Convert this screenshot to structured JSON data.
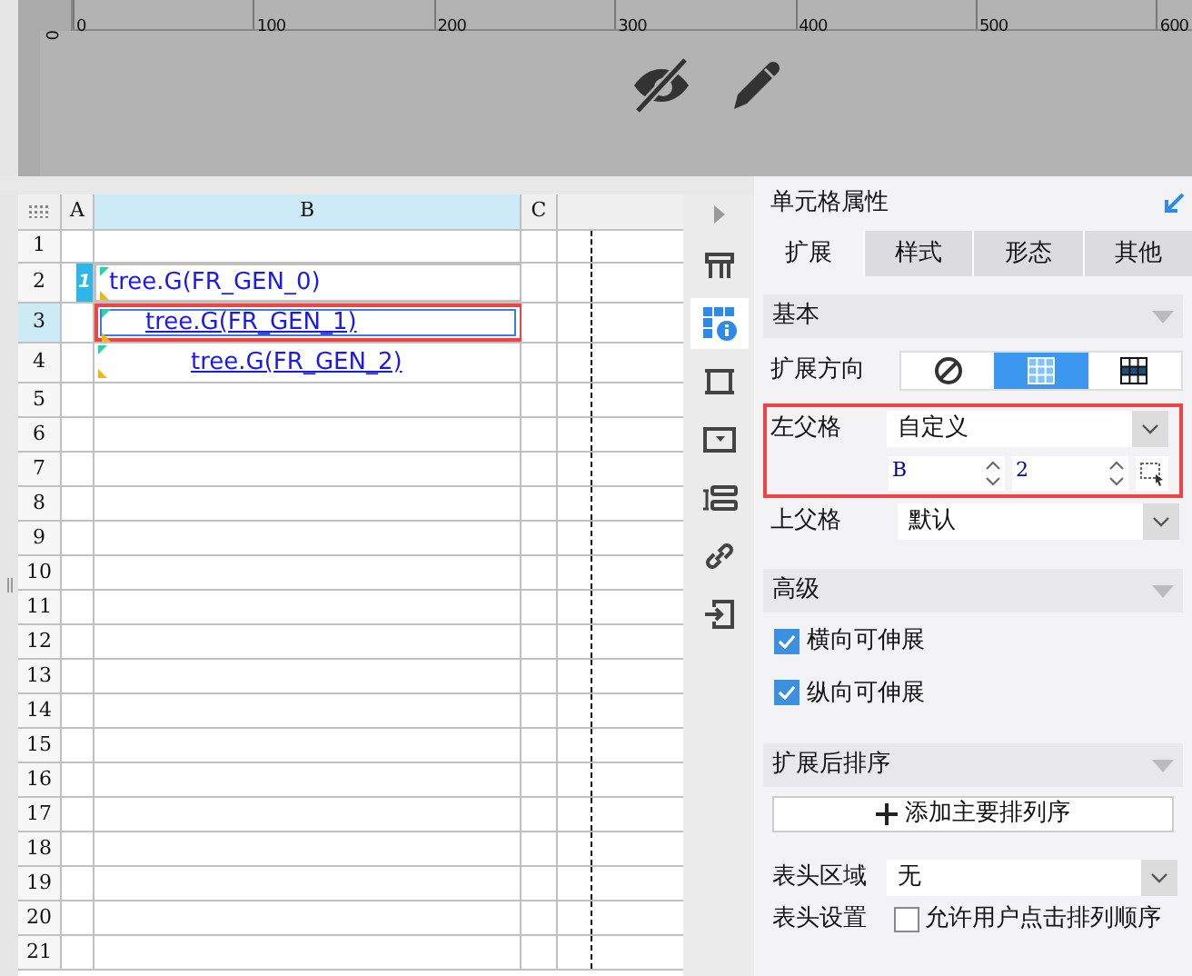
{
  "canvas": {
    "ruler_labels": [
      "0",
      "100",
      "200",
      "300",
      "400",
      "500",
      "600"
    ],
    "vertical_ruler_label": "0"
  },
  "sheet": {
    "columns": [
      {
        "label": "A",
        "selected": false
      },
      {
        "label": "B",
        "selected": true
      },
      {
        "label": "C",
        "selected": false
      }
    ],
    "rows": [
      {
        "label": "1",
        "selected": false
      },
      {
        "label": "2",
        "selected": false,
        "badge": "1",
        "cell_b": {
          "text": "tree.G(FR_GEN_0)",
          "underlined": false
        }
      },
      {
        "label": "3",
        "selected": true,
        "cell_b": {
          "text": "tree.G(FR_GEN_1)",
          "underlined": true
        }
      },
      {
        "label": "4",
        "selected": false,
        "cell_b": {
          "text": "tree.G(FR_GEN_2)",
          "underlined": true
        }
      },
      {
        "label": "5",
        "selected": false
      },
      {
        "label": "6",
        "selected": false
      },
      {
        "label": "7",
        "selected": false
      },
      {
        "label": "8",
        "selected": false
      },
      {
        "label": "9",
        "selected": false
      },
      {
        "label": "10",
        "selected": false
      },
      {
        "label": "11",
        "selected": false
      },
      {
        "label": "12",
        "selected": false
      },
      {
        "label": "13",
        "selected": false
      },
      {
        "label": "14",
        "selected": false
      },
      {
        "label": "15",
        "selected": false
      },
      {
        "label": "16",
        "selected": false
      },
      {
        "label": "17",
        "selected": false
      },
      {
        "label": "18",
        "selected": false
      },
      {
        "label": "19",
        "selected": false
      },
      {
        "label": "20",
        "selected": false
      },
      {
        "label": "21",
        "selected": false
      }
    ]
  },
  "sidebar": {
    "items": [
      {
        "kind": "table",
        "selected": false
      },
      {
        "kind": "cell",
        "selected": true
      },
      {
        "kind": "frame",
        "selected": false
      },
      {
        "kind": "widget",
        "selected": false
      },
      {
        "kind": "form",
        "selected": false
      },
      {
        "kind": "link",
        "selected": false
      },
      {
        "kind": "import",
        "selected": false
      }
    ]
  },
  "panel": {
    "title": "单元格属性",
    "tabs": [
      {
        "label": "扩展",
        "selected": true
      },
      {
        "label": "样式",
        "selected": false
      },
      {
        "label": "形态",
        "selected": false
      },
      {
        "label": "其他",
        "selected": false
      }
    ],
    "basic": {
      "header": "基本",
      "direction": {
        "label": "扩展方向",
        "options": [
          {
            "kind": "none",
            "selected": false
          },
          {
            "kind": "vertical",
            "selected": true
          },
          {
            "kind": "horizontal",
            "selected": false
          }
        ]
      },
      "left_parent": {
        "label": "左父格",
        "value": "自定义",
        "column": "B",
        "row": "2"
      },
      "top_parent": {
        "label": "上父格",
        "value": "默认"
      }
    },
    "advanced": {
      "header": "高级",
      "options": [
        {
          "label": "横向可伸展",
          "checked": true
        },
        {
          "label": "纵向可伸展",
          "checked": true
        }
      ]
    },
    "sorting": {
      "header": "扩展后排序",
      "add_button": "添加主要排列序"
    },
    "header_area": {
      "label": "表头区域",
      "value": "无"
    },
    "header_setting": {
      "label": "表头设置",
      "option": "允许用户点击排列顺序",
      "checked": false
    }
  }
}
